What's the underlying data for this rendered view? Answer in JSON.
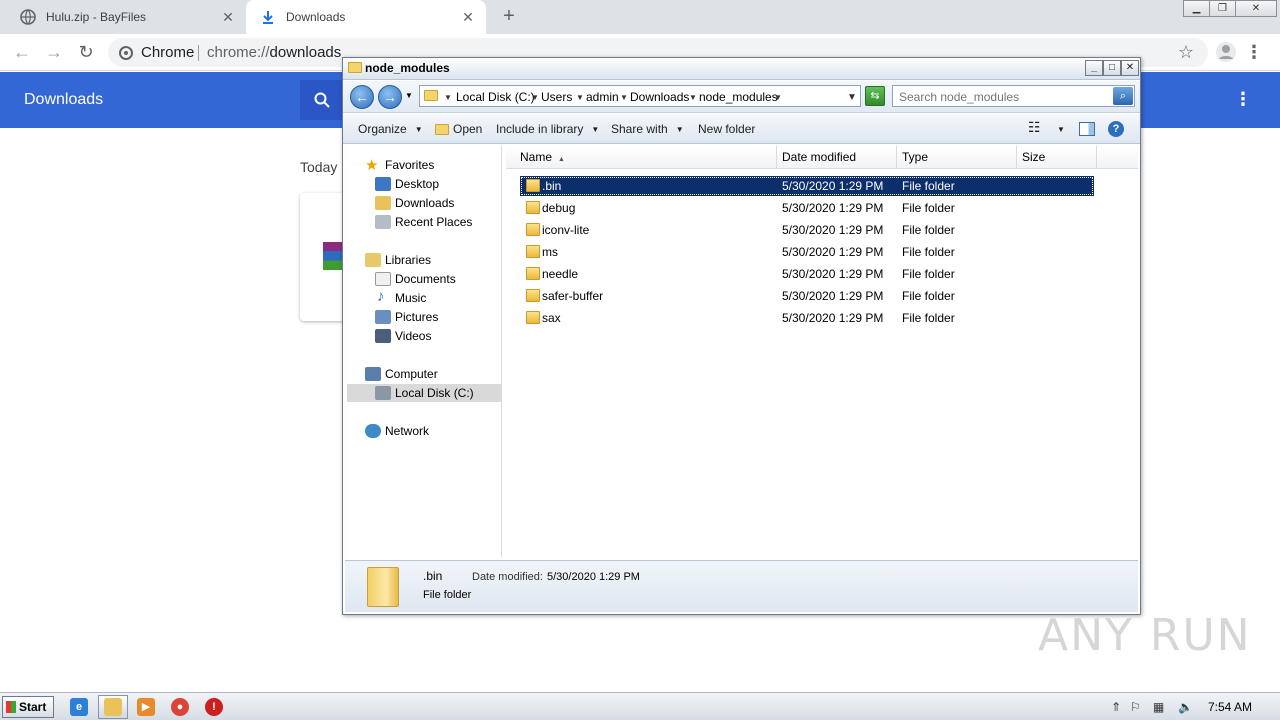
{
  "browser": {
    "tabs": [
      {
        "title": "Hulu.zip - BayFiles",
        "active": false
      },
      {
        "title": "Downloads",
        "active": true
      }
    ],
    "omnibox": {
      "scheme_label": "Chrome",
      "url_prefix": "chrome://",
      "url_host": "downloads"
    }
  },
  "downloads_page": {
    "title": "Downloads",
    "section_today": "Today"
  },
  "explorer": {
    "title": "node_modules",
    "breadcrumb": [
      "Local Disk (C:)",
      "Users",
      "admin",
      "Downloads",
      "node_modules"
    ],
    "search_placeholder": "Search node_modules",
    "commands": [
      "Organize",
      "Open",
      "Include in library",
      "Share with",
      "New folder"
    ],
    "nav": {
      "favorites": "Favorites",
      "favorite_items": [
        "Desktop",
        "Downloads",
        "Recent Places"
      ],
      "libraries": "Libraries",
      "library_items": [
        "Documents",
        "Music",
        "Pictures",
        "Videos"
      ],
      "computer": "Computer",
      "computer_items": [
        "Local Disk (C:)"
      ],
      "network": "Network"
    },
    "columns": [
      "Name",
      "Date modified",
      "Type",
      "Size"
    ],
    "rows": [
      {
        "name": ".bin",
        "date": "5/30/2020 1:29 PM",
        "type": "File folder",
        "selected": true
      },
      {
        "name": "debug",
        "date": "5/30/2020 1:29 PM",
        "type": "File folder"
      },
      {
        "name": "iconv-lite",
        "date": "5/30/2020 1:29 PM",
        "type": "File folder"
      },
      {
        "name": "ms",
        "date": "5/30/2020 1:29 PM",
        "type": "File folder"
      },
      {
        "name": "needle",
        "date": "5/30/2020 1:29 PM",
        "type": "File folder"
      },
      {
        "name": "safer-buffer",
        "date": "5/30/2020 1:29 PM",
        "type": "File folder"
      },
      {
        "name": "sax",
        "date": "5/30/2020 1:29 PM",
        "type": "File folder"
      }
    ],
    "details": {
      "name": ".bin",
      "date_label": "Date modified:",
      "date_value": "5/30/2020 1:29 PM",
      "type": "File folder"
    }
  },
  "watermark": "ANY RUN",
  "taskbar": {
    "start_label": "Start",
    "clock": "7:54 AM"
  },
  "colors": {
    "chrome_header": "#3367d6",
    "selection": "#0c2e6b"
  }
}
